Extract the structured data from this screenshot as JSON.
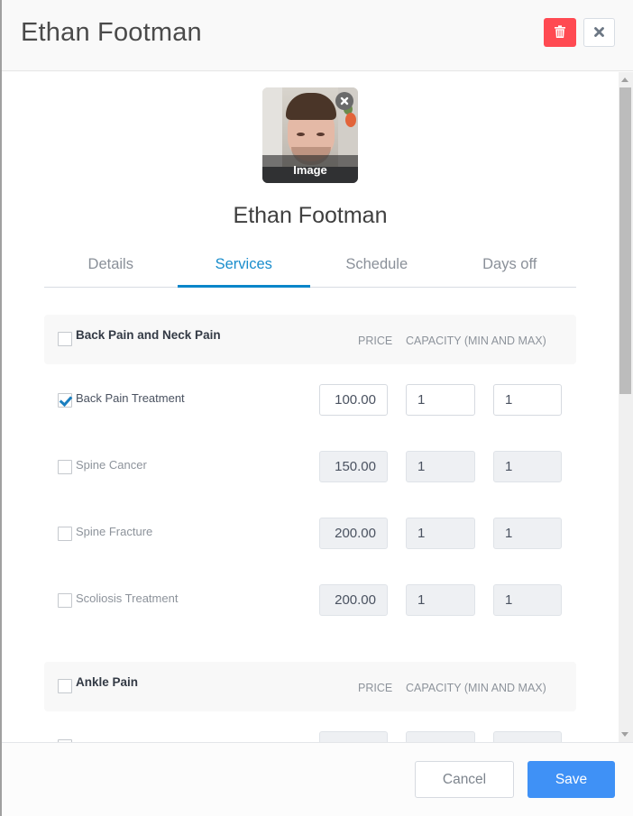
{
  "header": {
    "title": "Ethan Footman",
    "delete_icon": "trash-icon",
    "close_icon": "close-x-icon"
  },
  "profile": {
    "image_caption": "Image",
    "remove_image_icon": "close-circle-icon",
    "name": "Ethan Footman"
  },
  "tabs": [
    {
      "label": "Details",
      "active": false
    },
    {
      "label": "Services",
      "active": true
    },
    {
      "label": "Schedule",
      "active": false
    },
    {
      "label": "Days off",
      "active": false
    }
  ],
  "columns": {
    "price": "PRICE",
    "capacity": "CAPACITY (MIN AND MAX)"
  },
  "groups": [
    {
      "title": "Back Pain and Neck Pain",
      "checked": false,
      "services": [
        {
          "name": "Back Pain Treatment",
          "checked": true,
          "price": "100.00",
          "min": "1",
          "max": "1"
        },
        {
          "name": "Spine Cancer",
          "checked": false,
          "price": "150.00",
          "min": "1",
          "max": "1"
        },
        {
          "name": "Spine Fracture",
          "checked": false,
          "price": "200.00",
          "min": "1",
          "max": "1"
        },
        {
          "name": "Scoliosis Treatment",
          "checked": false,
          "price": "200.00",
          "min": "1",
          "max": "1"
        }
      ]
    },
    {
      "title": "Ankle Pain",
      "checked": false,
      "services": []
    }
  ],
  "footer": {
    "cancel_label": "Cancel",
    "save_label": "Save"
  },
  "colors": {
    "accent": "#0a86c9",
    "save": "#3f91f6",
    "delete": "#ff4a52"
  }
}
